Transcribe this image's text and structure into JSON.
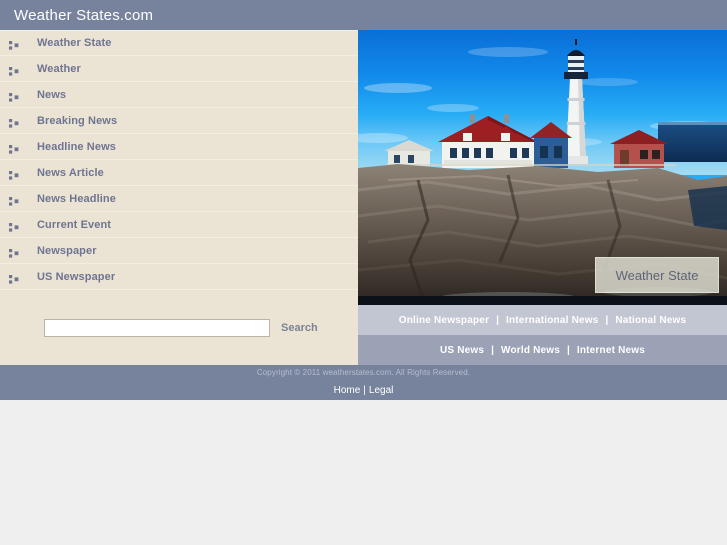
{
  "header": {
    "title": "Weather States.com",
    "bg_color": "#77839d"
  },
  "sidebar": {
    "bg_color": "#ebe4d4",
    "items": [
      {
        "label": "Weather State",
        "icon": "bullet-squares-icon"
      },
      {
        "label": "Weather",
        "icon": "bullet-squares-icon"
      },
      {
        "label": "News",
        "icon": "bullet-squares-icon"
      },
      {
        "label": "Breaking News",
        "icon": "bullet-squares-icon"
      },
      {
        "label": "Headline News",
        "icon": "bullet-squares-icon"
      },
      {
        "label": "News Article",
        "icon": "bullet-squares-icon"
      },
      {
        "label": "News Headline",
        "icon": "bullet-squares-icon"
      },
      {
        "label": "Current Event",
        "icon": "bullet-squares-icon"
      },
      {
        "label": "Newspaper",
        "icon": "bullet-squares-icon"
      },
      {
        "label": "US Newspaper",
        "icon": "bullet-squares-icon"
      }
    ],
    "search": {
      "value": "",
      "placeholder": "",
      "button_label": "Search"
    }
  },
  "content": {
    "photo": {
      "alt": "lighthouse-photo",
      "badge_label": "Weather State"
    },
    "linkbar_top": {
      "bg_color": "#c2c6d2",
      "separator": "|",
      "links": [
        "Online Newspaper",
        "International News",
        "National News"
      ]
    },
    "linkbar_bottom": {
      "bg_color": "#9ba2b6",
      "separator": "|",
      "links": [
        "US News",
        "World News",
        "Internet News"
      ]
    }
  },
  "footer": {
    "bg_color": "#77839d",
    "copyright": "Copyright © 2011 weatherstates.com. All Rights Reserved.",
    "separator": "|",
    "links": [
      "Home",
      "Legal"
    ]
  }
}
